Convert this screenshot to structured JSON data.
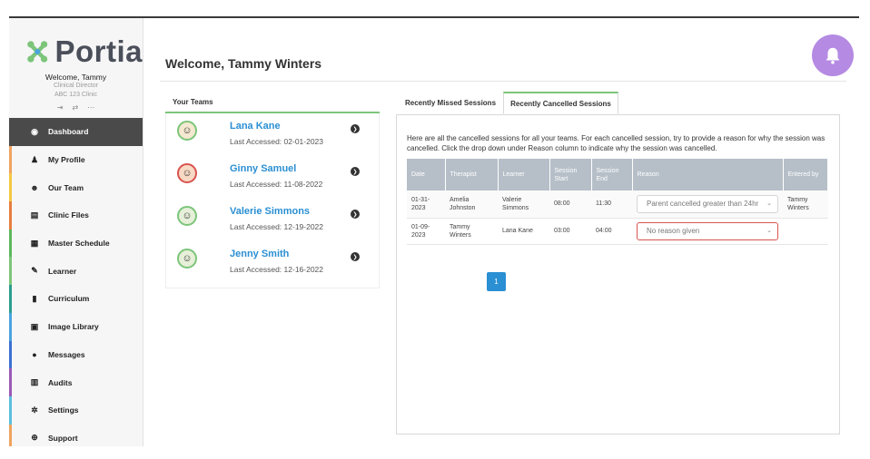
{
  "app": {
    "brand": "Portia",
    "accent_color": "#7cc57a",
    "link_color": "#2a8fd3"
  },
  "user": {
    "welcome": "Welcome, Tammy",
    "role": "Clinical Director",
    "clinic": "ABC 123 Clinic"
  },
  "sidebar": {
    "items": [
      {
        "label": "Dashboard",
        "icon": "dashboard-icon",
        "glyph": "◉",
        "active": true,
        "color": "#4a4a4a"
      },
      {
        "label": "My Profile",
        "icon": "user-icon",
        "glyph": "♟",
        "color": "#f0a35e"
      },
      {
        "label": "Our Team",
        "icon": "team-icon",
        "glyph": "☻",
        "color": "#f5c842"
      },
      {
        "label": "Clinic Files",
        "icon": "file-icon",
        "glyph": "▤",
        "color": "#e87d3e"
      },
      {
        "label": "Master Schedule",
        "icon": "calendar-icon",
        "glyph": "▦",
        "color": "#5cb85c"
      },
      {
        "label": "Learner",
        "icon": "pencil-icon",
        "glyph": "✎",
        "color": "#7cc57a"
      },
      {
        "label": "Curriculum",
        "icon": "book-icon",
        "glyph": "▮",
        "color": "#2a9d8f"
      },
      {
        "label": "Image Library",
        "icon": "image-icon",
        "glyph": "▣",
        "color": "#4aa3df"
      },
      {
        "label": "Messages",
        "icon": "chat-icon",
        "glyph": "●",
        "color": "#3b6fd1"
      },
      {
        "label": "Audits",
        "icon": "bar-chart-icon",
        "glyph": "▥",
        "color": "#9b59b6"
      },
      {
        "label": "Settings",
        "icon": "gear-icon",
        "glyph": "✲",
        "color": "#5bc0de"
      },
      {
        "label": "Support",
        "icon": "life-ring-icon",
        "glyph": "⊕",
        "color": "#f0a35e"
      }
    ]
  },
  "header": {
    "title": "Welcome, Tammy Winters",
    "bell_color": "#b48ae3"
  },
  "teams": {
    "heading": "Your Teams",
    "members": [
      {
        "name": "Lana Kane",
        "accessed": "Last Accessed: 02-01-2023"
      },
      {
        "name": "Ginny Samuel",
        "accessed": "Last Accessed: 11-08-2022"
      },
      {
        "name": "Valerie Simmons",
        "accessed": "Last Accessed: 12-19-2022"
      },
      {
        "name": "Jenny Smith",
        "accessed": "Last Accessed: 12-16-2022"
      }
    ]
  },
  "tabs": [
    {
      "label": "Recently Missed Sessions",
      "active": false
    },
    {
      "label": "Recently Cancelled Sessions",
      "active": true
    }
  ],
  "cancelled": {
    "intro": "Here are all the cancelled sessions for all your teams. For each cancelled session, try to provide a reason for why the session was cancelled. Click the drop down under Reason column to indicate why the session was cancelled.",
    "columns": [
      "Date",
      "Therapist",
      "Learner",
      "Session Start",
      "Session End",
      "Reason",
      "Entered by"
    ],
    "rows": [
      {
        "date": "01-31-2023",
        "therapist": "Amelia Johnston",
        "learner": "Valerie Simmons",
        "start": "08:00",
        "end": "11:30",
        "reason": "Parent cancelled greater than 24hr",
        "entered_by": "Tammy Winters"
      },
      {
        "date": "01-09-2023",
        "therapist": "Tammy Winters",
        "learner": "Lana Kane",
        "start": "03:00",
        "end": "04:00",
        "reason": "No reason given",
        "entered_by": ""
      }
    ],
    "page": "1"
  }
}
